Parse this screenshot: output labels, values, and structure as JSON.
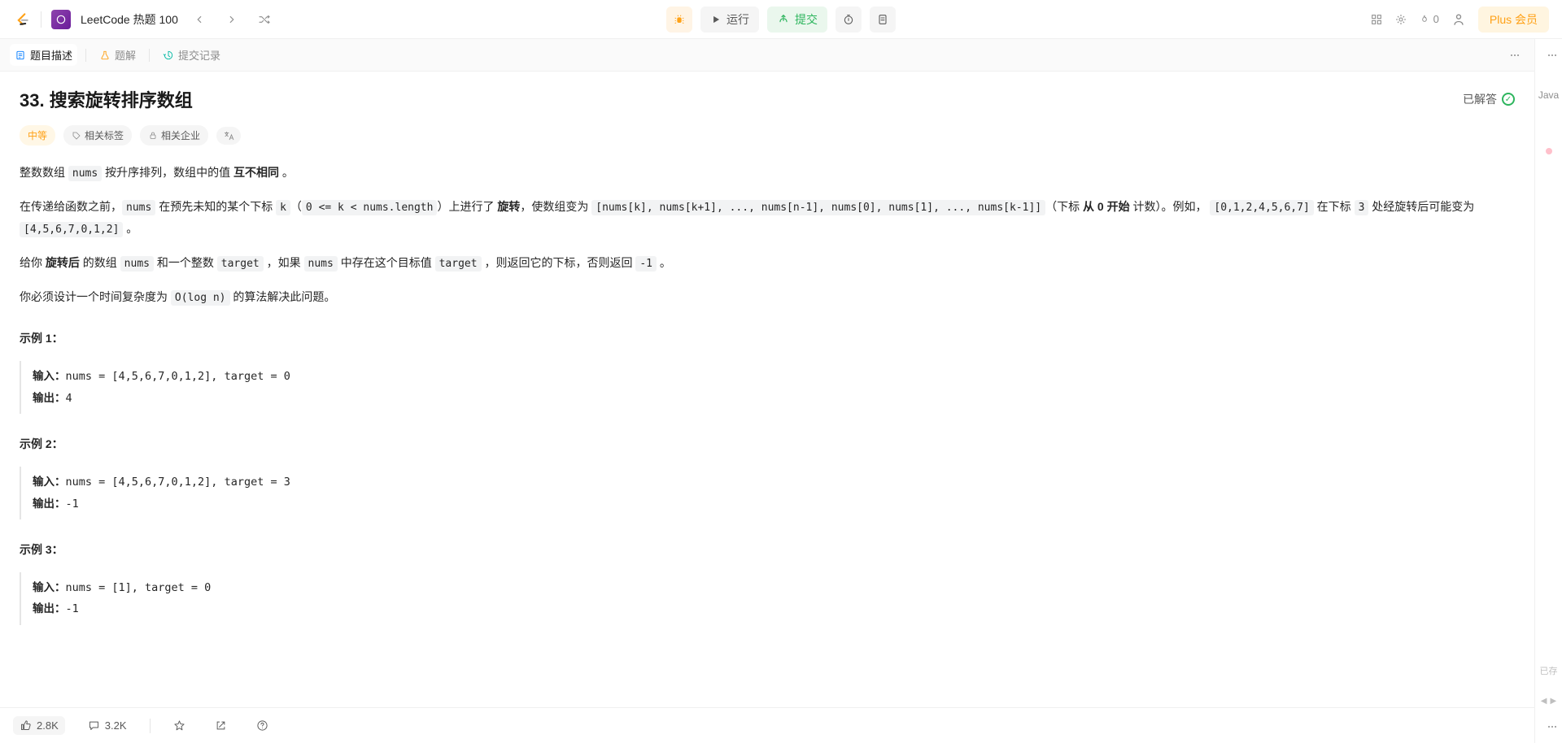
{
  "topbar": {
    "list_title": "LeetCode 热题 100",
    "run_label": "运行",
    "submit_label": "提交",
    "streak_count": "0",
    "plus_label": "Plus 会员"
  },
  "tabs": {
    "description": "题目描述",
    "solution": "题解",
    "submissions": "提交记录"
  },
  "problem": {
    "title": "33. 搜索旋转排序数组",
    "solved_label": "已解答",
    "difficulty": "中等",
    "tags_label": "相关标签",
    "companies_label": "相关企业"
  },
  "description": {
    "p1_a": "整数数组 ",
    "p1_code1": "nums",
    "p1_b": " 按升序排列，数组中的值 ",
    "p1_strong": "互不相同",
    "p1_c": " 。",
    "p2_a": "在传递给函数之前，",
    "p2_code1": "nums",
    "p2_b": " 在预先未知的某个下标 ",
    "p2_code2": "k",
    "p2_c": "（",
    "p2_code3": "0 <= k < nums.length",
    "p2_d": "）上进行了 ",
    "p2_strong1": "旋转",
    "p2_e": "，使数组变为 ",
    "p2_code4": "[nums[k], nums[k+1], ..., nums[n-1], nums[0], nums[1], ..., nums[k-1]]",
    "p2_f": "（下标 ",
    "p2_strong2": "从 0 开始",
    "p2_g": " 计数）。例如， ",
    "p2_code5": "[0,1,2,4,5,6,7]",
    "p2_h": " 在下标 ",
    "p2_code6": "3",
    "p2_i": " 处经旋转后可能变为 ",
    "p2_code7": "[4,5,6,7,0,1,2]",
    "p2_j": " 。",
    "p3_a": "给你 ",
    "p3_strong": "旋转后",
    "p3_b": " 的数组 ",
    "p3_code1": "nums",
    "p3_c": " 和一个整数 ",
    "p3_code2": "target",
    "p3_d": " ，如果 ",
    "p3_code3": "nums",
    "p3_e": " 中存在这个目标值 ",
    "p3_code4": "target",
    "p3_f": " ，则返回它的下标，否则返回 ",
    "p3_code5": "-1",
    "p3_g": " 。",
    "p4_a": "你必须设计一个时间复杂度为 ",
    "p4_code1": "O(log n)",
    "p4_b": " 的算法解决此问题。"
  },
  "examples": {
    "labels": {
      "input": "输入：",
      "output": "输出："
    },
    "e1": {
      "title": "示例 1：",
      "input": "nums = [4,5,6,7,0,1,2], target = 0",
      "output": "4"
    },
    "e2": {
      "title": "示例 2：",
      "input": "nums = [4,5,6,7,0,1,2], target = 3",
      "output": "-1"
    },
    "e3": {
      "title": "示例 3：",
      "input": "nums = [1], target = 0",
      "output": "-1"
    }
  },
  "footer": {
    "likes": "2.8K",
    "comments": "3.2K"
  },
  "right": {
    "lang": "Java",
    "saved": "已存"
  }
}
